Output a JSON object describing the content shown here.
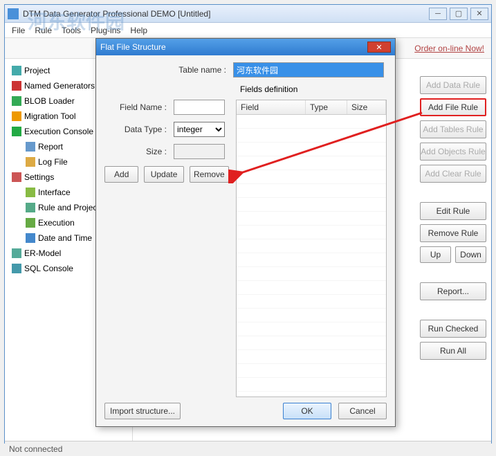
{
  "window": {
    "title": "DTM Data Generator Professional DEMO [Untitled]",
    "menu": {
      "file": "File",
      "rule": "Rule",
      "tools": "Tools",
      "plugins": "Plug-ins",
      "help": "Help"
    },
    "order_link": "Order on-line Now!",
    "status": "Not connected"
  },
  "watermark": "河东软件园",
  "tree": {
    "items": [
      {
        "label": "Project",
        "icon": "#4aa"
      },
      {
        "label": "Named Generators",
        "icon": "#c33"
      },
      {
        "label": "BLOB Loader",
        "icon": "#3a5"
      },
      {
        "label": "Migration Tool",
        "icon": "#e90"
      },
      {
        "label": "Execution Console",
        "icon": "#2a4"
      },
      {
        "label": "Report",
        "icon": "#69c",
        "child": true
      },
      {
        "label": "Log File",
        "icon": "#da4",
        "child": true
      },
      {
        "label": "Settings",
        "icon": "#c55"
      },
      {
        "label": "Interface",
        "icon": "#8b4",
        "child": true
      },
      {
        "label": "Rule and Project",
        "icon": "#5a8",
        "child": true
      },
      {
        "label": "Execution",
        "icon": "#6a4",
        "child": true
      },
      {
        "label": "Date and Time",
        "icon": "#48c",
        "child": true
      },
      {
        "label": "ER-Model",
        "icon": "#5a9"
      },
      {
        "label": "SQL Console",
        "icon": "#49a"
      }
    ]
  },
  "right_buttons": {
    "add_data": "Add Data Rule",
    "add_file": "Add File Rule",
    "add_tables": "Add Tables Rule",
    "add_objects": "Add Objects Rule",
    "add_clear": "Add Clear Rule",
    "edit": "Edit Rule",
    "remove": "Remove Rule",
    "up": "Up",
    "down": "Down",
    "report": "Report...",
    "run_checked": "Run Checked",
    "run_all": "Run All"
  },
  "dialog": {
    "title": "Flat File Structure",
    "table_name_label": "Table name :",
    "table_name_value": "河东软件园",
    "fields_def": "Fields definition",
    "field_name_label": "Field Name :",
    "field_name_value": "",
    "data_type_label": "Data Type :",
    "data_type_value": "integer",
    "size_label": "Size :",
    "size_value": "",
    "add": "Add",
    "update": "Update",
    "remove": "Remove",
    "import": "Import structure...",
    "ok": "OK",
    "cancel": "Cancel",
    "table": {
      "field": "Field",
      "type": "Type",
      "size": "Size"
    }
  }
}
